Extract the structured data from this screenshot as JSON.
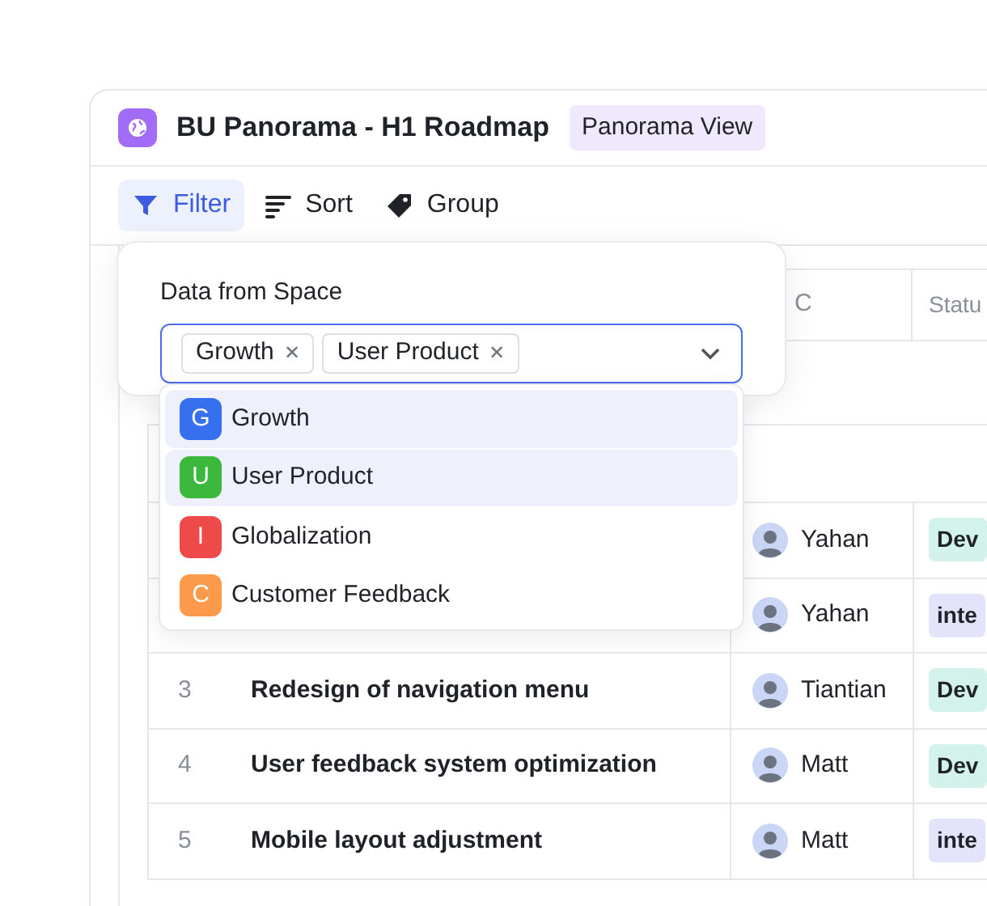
{
  "header": {
    "title": "BU Panorama - H1 Roadmap",
    "badge": "Panorama View"
  },
  "toolbar": [
    {
      "label": "Filter",
      "kind": "filter",
      "selected": true
    },
    {
      "label": "Sort",
      "kind": "sort",
      "selected": false
    },
    {
      "label": "Group",
      "kind": "group",
      "selected": false
    }
  ],
  "table": {
    "columns": [
      "C",
      "Statu"
    ],
    "rows": [
      {
        "number": "",
        "title": "",
        "pic": "Yahan",
        "status": "Dev",
        "color": "#d3f2ec"
      },
      {
        "number": "",
        "title": "",
        "pic": "Yahan",
        "status": "inte",
        "color": "#e3e3fb"
      },
      {
        "number": "3",
        "title": "Redesign of navigation menu",
        "pic": "Tiantian",
        "status": "Dev",
        "color": "#d3f2ec"
      },
      {
        "number": "4",
        "title": "User feedback system optimization",
        "pic": "Matt",
        "status": "Dev",
        "color": "#d3f2ec"
      },
      {
        "number": "5",
        "title": "Mobile layout adjustment",
        "pic": "Matt",
        "status": "inte",
        "color": "#e3e3fb"
      }
    ]
  },
  "filter_popover": {
    "label": "Data from Space",
    "chips": [
      "Growth",
      "User Product"
    ],
    "chip_remove": "✕",
    "options": [
      {
        "letter": "G",
        "label": "Growth",
        "color": "#3770ef",
        "selected": true
      },
      {
        "letter": "U",
        "label": "User Product",
        "color": "#3cb83c",
        "selected": true
      },
      {
        "letter": "I",
        "label": "Globalization",
        "color": "#ef4a4a",
        "selected": false
      },
      {
        "letter": "C",
        "label": "Customer Feedback",
        "color": "#fb9a4a",
        "selected": false
      }
    ]
  }
}
